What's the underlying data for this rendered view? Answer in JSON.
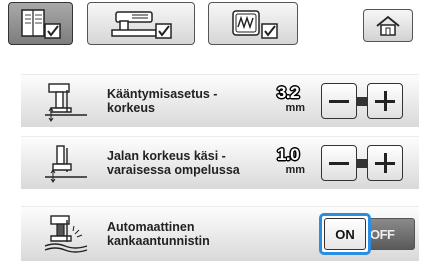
{
  "tabs": [
    {
      "icon": "settings-page-icon",
      "active": true
    },
    {
      "icon": "sewing-machine-settings-icon",
      "active": false
    },
    {
      "icon": "embroidery-settings-icon",
      "active": false
    }
  ],
  "home": {
    "icon": "home-icon"
  },
  "rows": [
    {
      "label_line1": "Kääntymisasetus -",
      "label_line2": "korkeus",
      "value": "3.2",
      "unit": "mm",
      "icon": "presser-foot-pivot-height-icon"
    },
    {
      "label_line1": "Jalan korkeus käsi -",
      "label_line2": "varaisessa ompelussa",
      "value": "1.0",
      "unit": "mm",
      "icon": "presser-foot-height-icon"
    },
    {
      "label_line1": "Automaattinen",
      "label_line2": "kankaantunnistin",
      "toggle_on": "ON",
      "toggle_off": "OFF",
      "icon": "automatic-fabric-sensor-icon"
    }
  ],
  "colors": {
    "selection": "#2a8de0",
    "active_tab": "#8c8c8c"
  }
}
